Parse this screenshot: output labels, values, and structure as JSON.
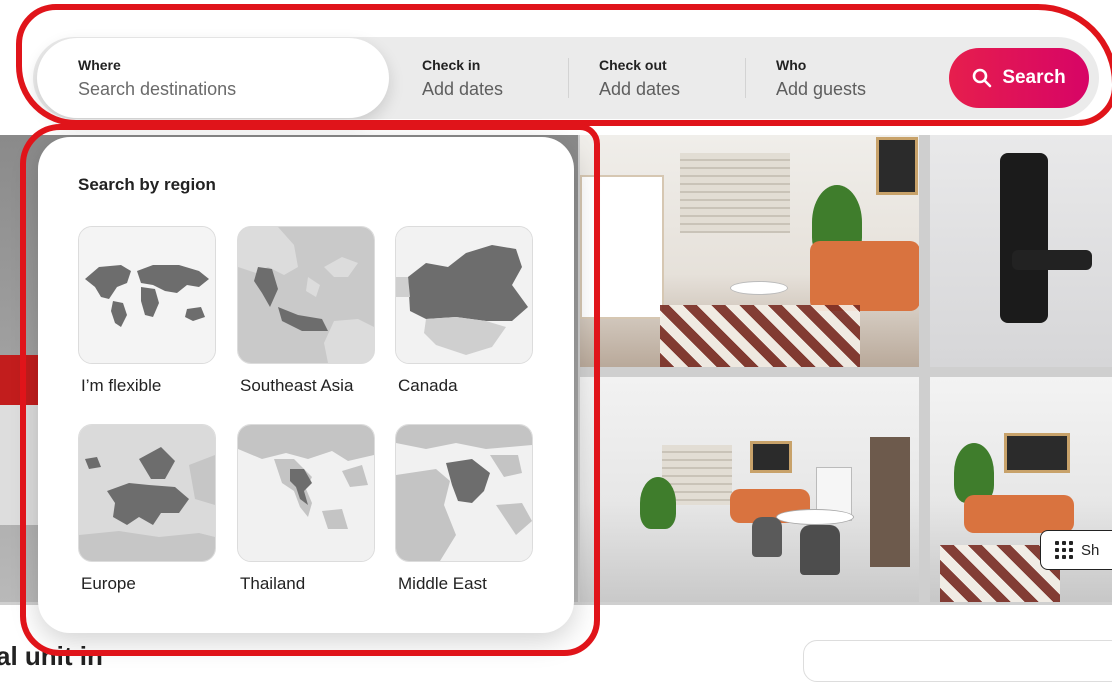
{
  "search": {
    "where_label": "Where",
    "where_placeholder": "Search destinations",
    "checkin_label": "Check in",
    "checkin_value": "Add dates",
    "checkout_label": "Check out",
    "checkout_value": "Add dates",
    "who_label": "Who",
    "who_value": "Add guests",
    "button_label": "Search"
  },
  "region_panel": {
    "title": "Search by region",
    "regions": [
      {
        "label": "I’m flexible"
      },
      {
        "label": "Southeast Asia"
      },
      {
        "label": "Canada"
      },
      {
        "label": "Europe"
      },
      {
        "label": "Thailand"
      },
      {
        "label": "Middle East"
      }
    ]
  },
  "gallery": {
    "show_button_label": "Sh"
  },
  "listing": {
    "title_partial": "al unit in"
  },
  "colors": {
    "brand_gradient_start": "#e61e4d",
    "brand_gradient_end": "#d70466",
    "annotation_red": "#e0141a"
  }
}
